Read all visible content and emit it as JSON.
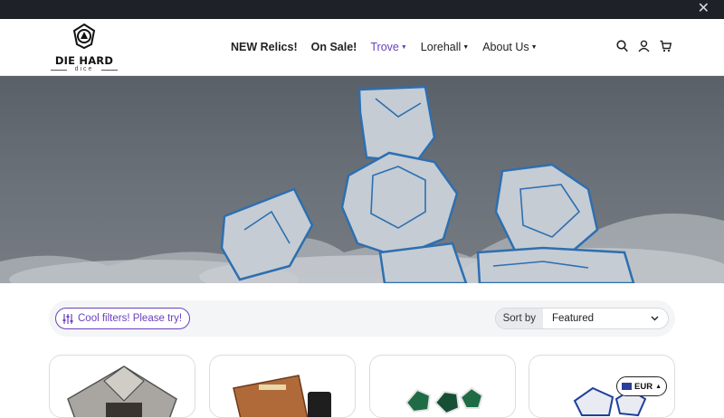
{
  "topbar": {
    "close_label": "✕"
  },
  "logo": {
    "brand": "DIE HARD",
    "sub": "dice"
  },
  "nav": [
    {
      "label": "NEW Relics!",
      "bold": true,
      "dropdown": false,
      "active": false
    },
    {
      "label": "On Sale!",
      "bold": true,
      "dropdown": false,
      "active": false
    },
    {
      "label": "Trove",
      "bold": false,
      "dropdown": true,
      "active": true
    },
    {
      "label": "Lorehall",
      "bold": false,
      "dropdown": true,
      "active": false
    },
    {
      "label": "About Us",
      "bold": false,
      "dropdown": true,
      "active": false
    }
  ],
  "header_icons": [
    "search-icon",
    "account-icon",
    "cart-icon"
  ],
  "filters": {
    "label": "Cool filters! Please try!"
  },
  "sort": {
    "label": "Sort by",
    "selected": "Featured"
  },
  "currency": {
    "code": "EUR"
  },
  "colors": {
    "accent": "#6c3fc0",
    "topbar": "#1e2228",
    "dice_blue": "#2d6fb0"
  }
}
